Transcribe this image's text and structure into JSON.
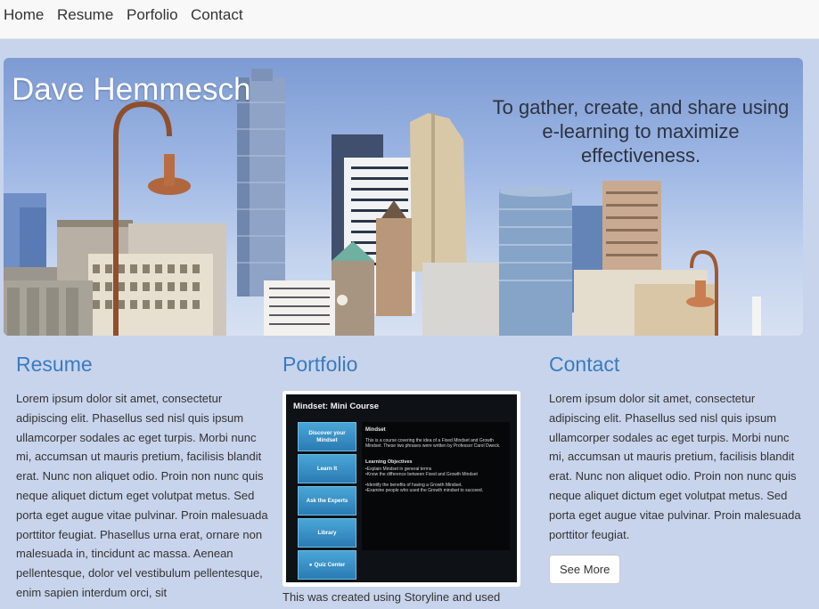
{
  "nav": {
    "items": [
      {
        "label": "Home"
      },
      {
        "label": "Resume"
      },
      {
        "label": "Porfolio"
      },
      {
        "label": "Contact"
      }
    ]
  },
  "hero": {
    "name": "Dave Hemmesch",
    "tagline": "To gather, create, and share using e-learning to maximize effectiveness."
  },
  "resume": {
    "heading": "Resume",
    "body": "Lorem ipsum dolor sit amet, consectetur adipiscing elit. Phasellus sed nisl quis ipsum ullamcorper sodales ac eget turpis. Morbi nunc mi, accumsan ut mauris pretium, facilisis blandit erat. Nunc non aliquet odio. Proin non nunc quis neque aliquet dictum eget volutpat metus. Sed porta eget augue vitae pulvinar. Proin malesuada porttitor feugiat. Phasellus urna erat, ornare non malesuada in, tincidunt ac massa. Aenean pellentesque, dolor vel vestibulum pellentesque, enim sapien interdum orci, sit"
  },
  "portfolio": {
    "heading": "Portfolio",
    "course_title": "Mindset: Mini Course",
    "buttons": [
      {
        "label": "Discover your Mindset"
      },
      {
        "label": "Learn It"
      },
      {
        "label": "Ask the Experts"
      },
      {
        "label": "Library"
      },
      {
        "label": "Quiz Center"
      }
    ],
    "panel_title": "Mindset",
    "panel_text": "This is a course covering the idea of a Fixed Mindset and Growth Mindset. These two phrases were written by Professor Carol Dweck.",
    "objectives_title": "Learning Objectives",
    "objectives": [
      "•Explain Mindset in general terms",
      "•Know the difference between Fixed and Growth Mindset",
      "•Identify the benefits of having a Growth Mindset.",
      "•Examine people who used the Growth mindset to succeed."
    ],
    "caption": "This was created using Storyline and used"
  },
  "contact": {
    "heading": "Contact",
    "body": "Lorem ipsum dolor sit amet, consectetur adipiscing elit. Phasellus sed nisl quis ipsum ullamcorper sodales ac eget turpis. Morbi nunc mi, accumsan ut mauris pretium, facilisis blandit erat. Nunc non aliquet odio. Proin non nunc quis neque aliquet dictum eget volutpat metus. Sed porta eget augue vitae pulvinar. Proin malesuada porttitor feugiat.",
    "button_label": "See More"
  },
  "colors": {
    "page_background": "#c8d4ec",
    "heading_blue": "#3a7bbf",
    "navbar_background": "#f8f8f8"
  }
}
